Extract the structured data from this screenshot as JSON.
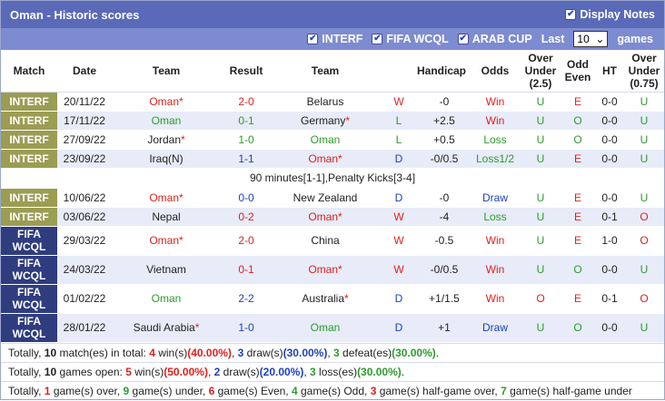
{
  "header": {
    "title": "Oman - Historic scores",
    "display_notes": "Display Notes"
  },
  "filters": {
    "interf": "INTERF",
    "fifa": "FIFA WCQL",
    "arab": "ARAB CUP",
    "last_label": "Last",
    "last_value": "10",
    "games_label": "games"
  },
  "columns": {
    "match": "Match",
    "date": "Date",
    "team1": "Team",
    "result": "Result",
    "team2": "Team",
    "handicap": "Handicap",
    "odds": "Odds",
    "over_under_1": "Over",
    "over_under_2": "Under",
    "over_under_3": "(2.5)",
    "odd_even_1": "Odd",
    "odd_even_2": "Even",
    "ht": "HT",
    "ou75_1": "Over",
    "ou75_2": "Under",
    "ou75_3": "(0.75)"
  },
  "rows": [
    {
      "league1": "INTERF",
      "league2": "",
      "date": "20/11/22",
      "team1": "Oman",
      "star1": "*",
      "result": "2-0",
      "team2": "Belarus",
      "star2": "",
      "wdl": "W",
      "hcp": "-0",
      "odds": "Win",
      "ou": "U",
      "oe": "E",
      "ht": "0-0",
      "ou75": "U"
    },
    {
      "league1": "INTERF",
      "league2": "",
      "date": "17/11/22",
      "team1": "Oman",
      "star1": "",
      "result": "0-1",
      "team2": "Germany",
      "star2": "*",
      "wdl": "L",
      "hcp": "+2.5",
      "odds": "Win",
      "ou": "U",
      "oe": "O",
      "ht": "0-0",
      "ou75": "U"
    },
    {
      "league1": "INTERF",
      "league2": "",
      "date": "27/09/22",
      "team1": "Jordan",
      "star1": "*",
      "result": "1-0",
      "team2": "Oman",
      "star2": "",
      "wdl": "L",
      "hcp": "+0.5",
      "odds": "Loss",
      "ou": "U",
      "oe": "O",
      "ht": "0-0",
      "ou75": "U"
    },
    {
      "league1": "INTERF",
      "league2": "",
      "date": "23/09/22",
      "team1": "Iraq(N)",
      "star1": "",
      "result": "1-1",
      "team2": "Oman",
      "star2": "*",
      "wdl": "D",
      "hcp": "-0/0.5",
      "odds": "Loss1/2",
      "ou": "U",
      "oe": "E",
      "ht": "0-0",
      "ou75": "U"
    },
    {
      "league1": "INTERF",
      "league2": "",
      "date": "10/06/22",
      "team1": "Oman",
      "star1": "*",
      "result": "0-0",
      "team2": "New Zealand",
      "star2": "",
      "wdl": "D",
      "hcp": "-0",
      "odds": "Draw",
      "ou": "U",
      "oe": "E",
      "ht": "0-0",
      "ou75": "U"
    },
    {
      "league1": "INTERF",
      "league2": "",
      "date": "03/06/22",
      "team1": "Nepal",
      "star1": "",
      "result": "0-2",
      "team2": "Oman",
      "star2": "*",
      "wdl": "W",
      "hcp": "-4",
      "odds": "Loss",
      "ou": "U",
      "oe": "E",
      "ht": "0-1",
      "ou75": "O"
    },
    {
      "league1": "FIFA",
      "league2": "WCQL",
      "date": "29/03/22",
      "team1": "Oman",
      "star1": "*",
      "result": "2-0",
      "team2": "China",
      "star2": "",
      "wdl": "W",
      "hcp": "-0.5",
      "odds": "Win",
      "ou": "U",
      "oe": "E",
      "ht": "1-0",
      "ou75": "O"
    },
    {
      "league1": "FIFA",
      "league2": "WCQL",
      "date": "24/03/22",
      "team1": "Vietnam",
      "star1": "",
      "result": "0-1",
      "team2": "Oman",
      "star2": "*",
      "wdl": "W",
      "hcp": "-0/0.5",
      "odds": "Win",
      "ou": "U",
      "oe": "O",
      "ht": "0-0",
      "ou75": "U"
    },
    {
      "league1": "FIFA",
      "league2": "WCQL",
      "date": "01/02/22",
      "team1": "Oman",
      "star1": "",
      "result": "2-2",
      "team2": "Australia",
      "star2": "*",
      "wdl": "D",
      "hcp": "+1/1.5",
      "odds": "Win",
      "ou": "O",
      "oe": "E",
      "ht": "0-1",
      "ou75": "O"
    },
    {
      "league1": "FIFA",
      "league2": "WCQL",
      "date": "28/01/22",
      "team1": "Saudi Arabia",
      "star1": "*",
      "result": "1-0",
      "team2": "Oman",
      "star2": "",
      "wdl": "D",
      "hcp": "+1",
      "odds": "Draw",
      "ou": "U",
      "oe": "O",
      "ht": "0-0",
      "ou75": "U"
    }
  ],
  "note": "90 minutes[1-1],Penalty Kicks[3-4]",
  "summary": {
    "line1": {
      "a": "Totally, ",
      "n": "10",
      "b": " match(es) in total: ",
      "w": "4",
      "c": " win(s)",
      "wp": "(40.00%)",
      "d": ", ",
      "dr": "3",
      "e": " draw(s)",
      "dp": "(30.00%)",
      "f": ", ",
      "l": "3",
      "g": " defeat(es)",
      "lp": "(30.00%)",
      "h": "."
    },
    "line2": {
      "a": "Totally, ",
      "n": "10",
      "b": " games open: ",
      "w": "5",
      "c": " win(s)",
      "wp": "(50.00%)",
      "d": ", ",
      "dr": "2",
      "e": " draw(s)",
      "dp": "(20.00%)",
      "f": ", ",
      "l": "3",
      "g": " loss(es)",
      "lp": "(30.00%)",
      "h": "."
    },
    "line3": {
      "a": "Totally, ",
      "o": "1",
      "b": " game(s) over, ",
      "u": "9",
      "c": " game(s) under, ",
      "ev": "6",
      "d": " game(s) Even, ",
      "od": "4",
      "e": " game(s) Odd, ",
      "ho": "3",
      "f": " game(s) half-game over, ",
      "hu": "7",
      "g": " game(s) half-game under"
    }
  }
}
